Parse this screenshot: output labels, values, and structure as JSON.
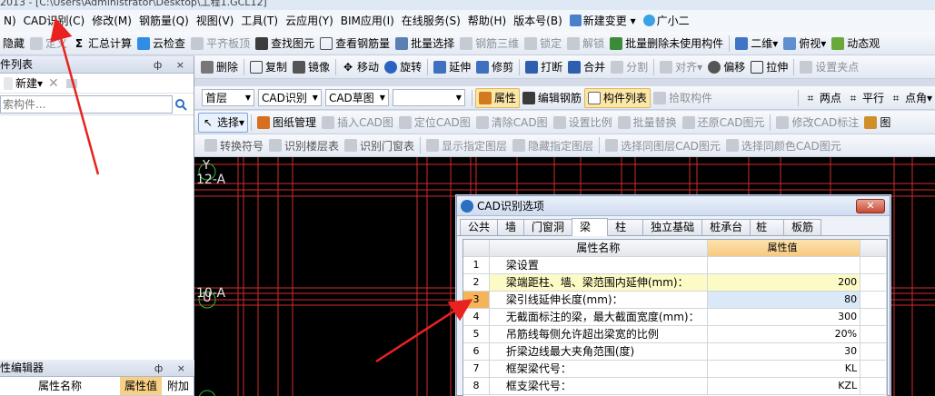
{
  "window": {
    "title": "2013 - [C:\\Users\\Administrator\\Desktop\\工程1.GCL12]"
  },
  "menu": [
    "N)",
    "CAD识别(C)",
    "修改(M)",
    "钢筋量(Q)",
    "视图(V)",
    "工具(T)",
    "云应用(Y)",
    "BIM应用(I)",
    "在线服务(S)",
    "帮助(H)",
    "版本号(B)",
    "新建变更",
    "广小二"
  ],
  "toolbar1": [
    "隐藏",
    "定义",
    "汇总计算",
    "云检查",
    "平齐板顶",
    "查找图元",
    "查看钢筋量",
    "批量选择",
    "钢筋三维",
    "锁定",
    "解锁",
    "批量删除未使用构件",
    "二维",
    "俯视",
    "动态观"
  ],
  "toolbar2": [
    "删除",
    "复制",
    "镜像",
    "移动",
    "旋转",
    "延伸",
    "修剪",
    "打断",
    "合并",
    "分割",
    "对齐",
    "偏移",
    "拉伸",
    "设置夹点"
  ],
  "toolbar3": {
    "floor": "首层",
    "mode": "CAD识别",
    "sketch": "CAD草图",
    "blank": "",
    "items": [
      "属性",
      "编辑钢筋",
      "构件列表",
      "拾取构件",
      "两点",
      "平行",
      "点角"
    ]
  },
  "toolbar4": [
    "选择",
    "图纸管理",
    "插入CAD图",
    "定位CAD图",
    "清除CAD图",
    "设置比例",
    "批量替换",
    "还原CAD图元",
    "修改CAD标注",
    "图"
  ],
  "toolbar5": [
    "转换符号",
    "识别楼层表",
    "识别门窗表",
    "显示指定图层",
    "隐藏指定图层",
    "选择同图层CAD图元",
    "选择同颜色CAD图元"
  ],
  "leftpanel": {
    "title": "件列表",
    "pin": "ф ×",
    "new_label": "新建",
    "search_placeholder": "索构件...",
    "editor_title": "性编辑器",
    "col_name": "属性名称",
    "col_value": "属性值",
    "col_extra": "附加"
  },
  "canvas": {
    "axis_labels": [
      "12-A",
      "10-A"
    ],
    "axis_marks": [
      "Y",
      "U"
    ]
  },
  "dialog": {
    "title": "CAD识别选项",
    "tabs": [
      "公共",
      "墙",
      "门窗洞",
      "梁",
      "柱",
      "独立基础",
      "桩承台",
      "桩",
      "板筋"
    ],
    "active_tab": "梁",
    "col_name": "属性名称",
    "col_value": "属性值",
    "rows": [
      {
        "n": "1",
        "name": "梁设置",
        "value": ""
      },
      {
        "n": "2",
        "name": "梁端距柱、墙、梁范围内延伸(mm)：",
        "value": "200"
      },
      {
        "n": "3",
        "name": "梁引线延伸长度(mm)：",
        "value": "80"
      },
      {
        "n": "4",
        "name": "无截面标注的梁，最大截面宽度(mm)：",
        "value": "300"
      },
      {
        "n": "5",
        "name": "吊筋线每侧允许超出梁宽的比例",
        "value": "20%"
      },
      {
        "n": "6",
        "name": "折梁边线最大夹角范围(度)",
        "value": "30"
      },
      {
        "n": "7",
        "name": "框架梁代号：",
        "value": "KL"
      },
      {
        "n": "8",
        "name": "框支梁代号：",
        "value": "KZL"
      }
    ]
  },
  "colors": {
    "accent": "#2a6fc0",
    "highlight": "#fdfbc5",
    "current_row": "#f6b45a",
    "arrow": "#e8231f"
  }
}
